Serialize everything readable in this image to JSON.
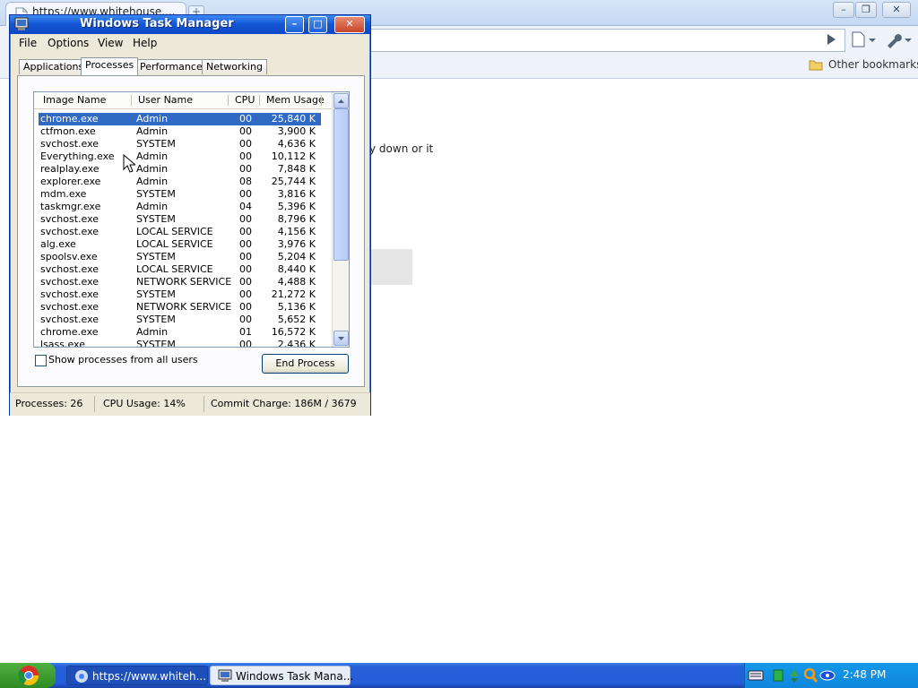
{
  "browser": {
    "tab_title": "https://www.whitehouse....",
    "new_tab_label": "+",
    "window_buttons": {
      "minimize": "–",
      "restore": "❐",
      "close": "✕"
    },
    "other_bookmarks": "Other bookmarks",
    "page_text_fragment": "y down or it"
  },
  "task_manager": {
    "title": "Windows Task Manager",
    "title_buttons": {
      "minimize": "–",
      "maximize": "□",
      "close": "✕"
    },
    "menu": [
      "File",
      "Options",
      "View",
      "Help"
    ],
    "tabs": [
      "Applications",
      "Processes",
      "Performance",
      "Networking"
    ],
    "active_tab": "Processes",
    "columns": [
      "Image Name",
      "User Name",
      "CPU",
      "Mem Usage"
    ],
    "processes": [
      {
        "name": "chrome.exe",
        "user": "Admin",
        "cpu": "00",
        "mem": "25,840 K",
        "selected": true
      },
      {
        "name": "ctfmon.exe",
        "user": "Admin",
        "cpu": "00",
        "mem": "3,900 K"
      },
      {
        "name": "svchost.exe",
        "user": "SYSTEM",
        "cpu": "00",
        "mem": "4,636 K"
      },
      {
        "name": "Everything.exe",
        "user": "Admin",
        "cpu": "00",
        "mem": "10,112 K"
      },
      {
        "name": "realplay.exe",
        "user": "Admin",
        "cpu": "00",
        "mem": "7,848 K"
      },
      {
        "name": "explorer.exe",
        "user": "Admin",
        "cpu": "08",
        "mem": "25,744 K"
      },
      {
        "name": "mdm.exe",
        "user": "SYSTEM",
        "cpu": "00",
        "mem": "3,816 K"
      },
      {
        "name": "taskmgr.exe",
        "user": "Admin",
        "cpu": "04",
        "mem": "5,396 K"
      },
      {
        "name": "svchost.exe",
        "user": "SYSTEM",
        "cpu": "00",
        "mem": "8,796 K"
      },
      {
        "name": "svchost.exe",
        "user": "LOCAL SERVICE",
        "cpu": "00",
        "mem": "4,156 K"
      },
      {
        "name": "alg.exe",
        "user": "LOCAL SERVICE",
        "cpu": "00",
        "mem": "3,976 K"
      },
      {
        "name": "spoolsv.exe",
        "user": "SYSTEM",
        "cpu": "00",
        "mem": "5,204 K"
      },
      {
        "name": "svchost.exe",
        "user": "LOCAL SERVICE",
        "cpu": "00",
        "mem": "8,440 K"
      },
      {
        "name": "svchost.exe",
        "user": "NETWORK SERVICE",
        "cpu": "00",
        "mem": "4,488 K"
      },
      {
        "name": "svchost.exe",
        "user": "SYSTEM",
        "cpu": "00",
        "mem": "21,272 K"
      },
      {
        "name": "svchost.exe",
        "user": "NETWORK SERVICE",
        "cpu": "00",
        "mem": "5,136 K"
      },
      {
        "name": "svchost.exe",
        "user": "SYSTEM",
        "cpu": "00",
        "mem": "5,652 K"
      },
      {
        "name": "chrome.exe",
        "user": "Admin",
        "cpu": "01",
        "mem": "16,572 K"
      },
      {
        "name": "lsass.exe",
        "user": "SYSTEM",
        "cpu": "00",
        "mem": "2,436 K"
      }
    ],
    "show_all_users_label": "Show processes from all users",
    "show_all_users_checked": false,
    "end_process_label": "End Process",
    "status": {
      "processes": "Processes: 26",
      "cpu_usage": "CPU Usage: 14%",
      "commit_charge": "Commit Charge: 186M / 3679"
    }
  },
  "taskbar": {
    "items": [
      {
        "label": "https://www.whiteh...",
        "active": true
      },
      {
        "label": "Windows Task Mana...",
        "active": false
      }
    ],
    "clock": "2:48 PM"
  },
  "colors": {
    "xp_title_blue": "#0a47c6",
    "selection_blue": "#316ac5",
    "taskbar_blue": "#245edb",
    "start_green": "#2f8a22",
    "dialog_beige": "#ece9d8"
  }
}
